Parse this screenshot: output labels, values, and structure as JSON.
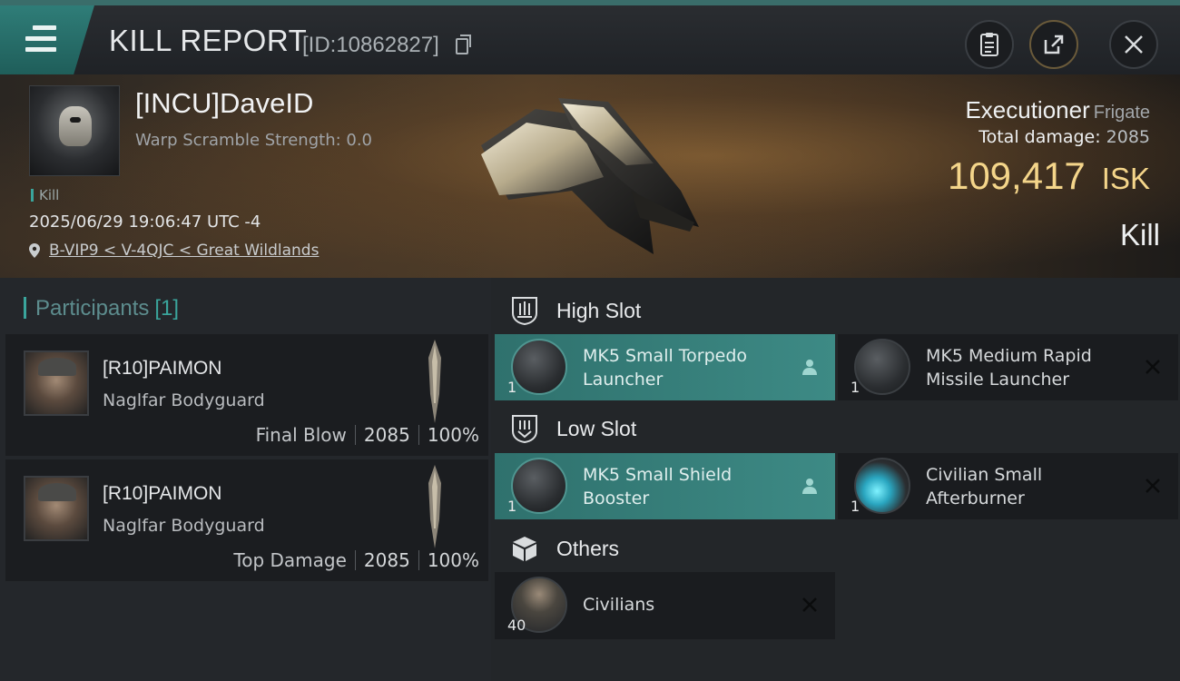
{
  "header": {
    "title": "KILL REPORT",
    "report_id": "[ID:10862827]"
  },
  "victim": {
    "name": "[INCU]DaveID",
    "warp_scramble": "Warp Scramble Strength: 0.0",
    "tag": "Kill",
    "timestamp": "2025/06/29 19:06:47 UTC -4",
    "location": "B-VIP9 < V-4QJC < Great Wildlands",
    "ship": "Executioner",
    "ship_class": "Frigate",
    "total_damage_label": "Total damage:",
    "total_damage": "2085",
    "isk_value": "109,417",
    "isk_unit": "ISK",
    "kill_type": "Kill"
  },
  "participants": {
    "label": "Participants",
    "count": "[1]",
    "rows": [
      {
        "name": "[R10]PAIMON",
        "ship": "Naglfar Bodyguard",
        "stat_label": "Final Blow",
        "damage": "2085",
        "percent": "100%"
      },
      {
        "name": "[R10]PAIMON",
        "ship": "Naglfar Bodyguard",
        "stat_label": "Top Damage",
        "damage": "2085",
        "percent": "100%"
      }
    ]
  },
  "fittings": {
    "high_slot": {
      "label": "High Slot",
      "modules": [
        {
          "name_line1": "MK5 Small Torpedo",
          "name_line2": "Launcher",
          "qty": "1",
          "status": "dropped"
        },
        {
          "name_line1": "MK5 Medium Rapid",
          "name_line2": "Missile Launcher",
          "qty": "1",
          "status": "destroyed"
        }
      ]
    },
    "low_slot": {
      "label": "Low Slot",
      "modules": [
        {
          "name_line1": "MK5 Small Shield",
          "name_line2": "Booster",
          "qty": "1",
          "status": "dropped"
        },
        {
          "name_line1": "Civilian Small",
          "name_line2": "Afterburner",
          "qty": "1",
          "status": "destroyed"
        }
      ]
    },
    "others": {
      "label": "Others",
      "modules": [
        {
          "name_line1": "Civilians",
          "qty": "40",
          "status": "destroyed"
        }
      ]
    }
  },
  "colors": {
    "accent_teal": "#3aa59c",
    "isk_gold": "#f4d58a",
    "highlight_row": "#3d8a85"
  }
}
